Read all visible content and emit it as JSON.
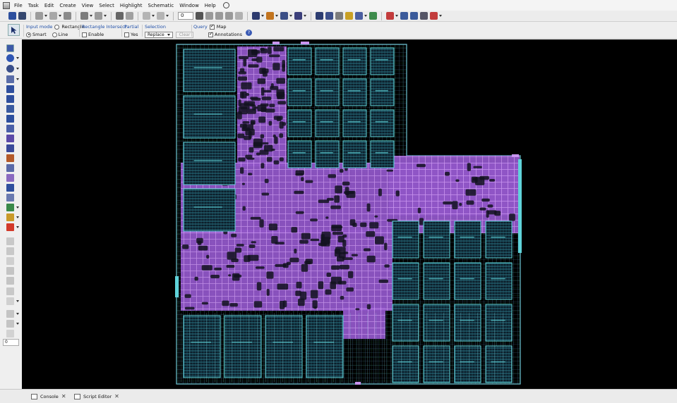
{
  "menu": {
    "items": [
      "File",
      "Task",
      "Edit",
      "Create",
      "View",
      "Select",
      "Highlight",
      "Schematic",
      "Window",
      "Help"
    ]
  },
  "toolbar": {
    "zoom_value": "0"
  },
  "options": {
    "input_mode": {
      "title": "Input mode",
      "rectangle": "Rectangle",
      "smart": "Smart",
      "line": "Line"
    },
    "rect_intersect": {
      "title": "Rectangle Intersect",
      "enable": "Enable"
    },
    "partial": {
      "title": "Partial",
      "yes": "Yes"
    },
    "selection": {
      "title": "Selection",
      "mode": "Replace",
      "clear": "Clear"
    },
    "query": {
      "title": "Query",
      "map": "Map",
      "annotations": "Annotations"
    }
  },
  "palette": {
    "field_value": "0"
  },
  "bottom_tabs": [
    {
      "label": "Console"
    },
    {
      "label": "Script Editor"
    }
  ],
  "colors": {
    "canvas_bg": "#000000",
    "macro_cyan": "#5fd3d9",
    "logic_purple": "#b06ee0",
    "grid_green": "#2e8b57"
  }
}
